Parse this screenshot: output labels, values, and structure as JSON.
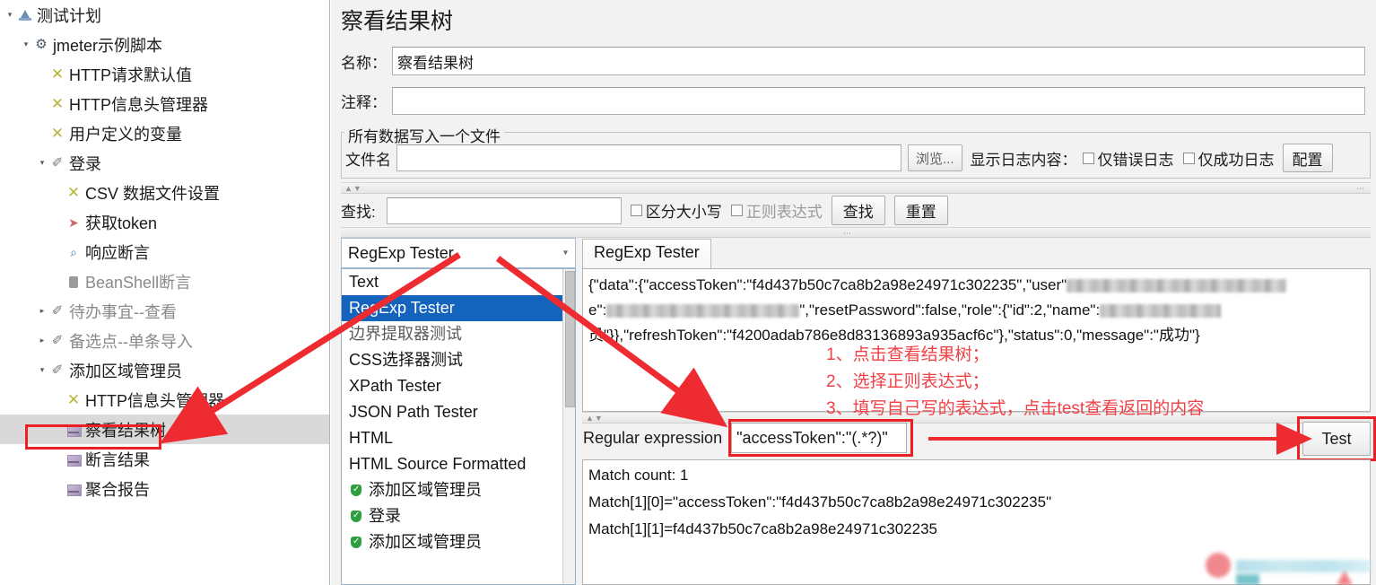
{
  "tree": {
    "items": [
      {
        "label": "测试计划",
        "icon": "test-plan-icon",
        "indent": 0,
        "toggle": "open",
        "dim": false,
        "selected": false
      },
      {
        "label": "jmeter示例脚本",
        "icon": "thread-group-icon",
        "indent": 1,
        "toggle": "open",
        "dim": false,
        "selected": false
      },
      {
        "label": "HTTP请求默认值",
        "icon": "config-element-icon",
        "indent": 2,
        "toggle": "blank",
        "dim": false,
        "selected": false
      },
      {
        "label": "HTTP信息头管理器",
        "icon": "config-element-icon",
        "indent": 2,
        "toggle": "blank",
        "dim": false,
        "selected": false
      },
      {
        "label": "用户定义的变量",
        "icon": "config-element-icon",
        "indent": 2,
        "toggle": "blank",
        "dim": false,
        "selected": false
      },
      {
        "label": "登录",
        "icon": "transaction-controller-icon",
        "indent": 2,
        "toggle": "open",
        "dim": false,
        "selected": false
      },
      {
        "label": "CSV 数据文件设置",
        "icon": "config-element-icon",
        "indent": 3,
        "toggle": "blank",
        "dim": false,
        "selected": false
      },
      {
        "label": "获取token",
        "icon": "http-request-icon",
        "indent": 3,
        "toggle": "blank",
        "dim": false,
        "selected": false
      },
      {
        "label": "响应断言",
        "icon": "assertion-icon",
        "indent": 3,
        "toggle": "blank",
        "dim": false,
        "selected": false
      },
      {
        "label": "BeanShell断言",
        "icon": "beanshell-icon",
        "indent": 3,
        "toggle": "blank",
        "dim": true,
        "selected": false
      },
      {
        "label": "待办事宜--查看",
        "icon": "transaction-controller-icon",
        "indent": 2,
        "toggle": "closed",
        "dim": true,
        "selected": false
      },
      {
        "label": "备选点--单条导入",
        "icon": "transaction-controller-icon",
        "indent": 2,
        "toggle": "closed",
        "dim": true,
        "selected": false
      },
      {
        "label": "添加区域管理员",
        "icon": "transaction-controller-icon",
        "indent": 2,
        "toggle": "open",
        "dim": false,
        "selected": false
      },
      {
        "label": "HTTP信息头管理器",
        "icon": "config-element-icon",
        "indent": 3,
        "toggle": "blank",
        "dim": false,
        "selected": false
      },
      {
        "label": "察看结果树",
        "icon": "listener-icon",
        "indent": 3,
        "toggle": "blank",
        "dim": false,
        "selected": true
      },
      {
        "label": "断言结果",
        "icon": "listener-icon",
        "indent": 3,
        "toggle": "blank",
        "dim": false,
        "selected": false
      },
      {
        "label": "聚合报告",
        "icon": "listener-icon",
        "indent": 3,
        "toggle": "blank",
        "dim": false,
        "selected": false
      }
    ]
  },
  "panel": {
    "title": "察看结果树",
    "name_label": "名称：",
    "name_value": "察看结果树",
    "comment_label": "注释：",
    "comment_value": "",
    "file_group_legend": "所有数据写入一个文件",
    "filename_label": "文件名",
    "filename_value": "",
    "browse_button": "浏览...",
    "log_display_label": "显示日志内容：",
    "only_errors_label": "仅错误日志",
    "only_success_label": "仅成功日志",
    "configure_button": "配置",
    "search_label": "查找:",
    "search_value": "",
    "case_sensitive_label": "区分大小写",
    "regexp_label": "正则表达式",
    "find_button": "查找",
    "reset_button": "重置"
  },
  "renderer": {
    "selected": "RegExp Tester",
    "tab_label": "RegExp Tester",
    "options": [
      {
        "label": "Text",
        "type": "plain",
        "selected": false
      },
      {
        "label": "RegExp Tester",
        "type": "plain",
        "selected": true
      },
      {
        "label": "边界提取器测试",
        "type": "plain-dim",
        "selected": false
      },
      {
        "label": "CSS选择器测试",
        "type": "plain",
        "selected": false
      },
      {
        "label": "XPath Tester",
        "type": "plain",
        "selected": false
      },
      {
        "label": "JSON Path Tester",
        "type": "plain",
        "selected": false
      },
      {
        "label": "HTML",
        "type": "plain",
        "selected": false
      },
      {
        "label": "HTML Source Formatted",
        "type": "plain",
        "selected": false
      },
      {
        "label": "添加区域管理员",
        "type": "shield",
        "selected": false
      },
      {
        "label": "登录",
        "type": "shield",
        "selected": false
      },
      {
        "label": "添加区域管理员",
        "type": "shield",
        "selected": false
      }
    ]
  },
  "response": {
    "line1_a": "{\"data\":{\"accessToken\":\"f4d437b50c7ca8b2a98e24971c302235\",\"user\"",
    "line2_a": "e\":",
    "line2_b": "\",\"resetPassword\":false,\"role\":{\"id\":2,\"name\":",
    "line3_a": "员\"}},\"refreshToken\":\"f4200adab786e8d83136893a935acf6c\"},\"status\":0,\"message\":\"成功\"}"
  },
  "regex": {
    "label": "Regular expression",
    "value": "\"accessToken\":\"(.*?)\"",
    "test_button": "Test"
  },
  "matches": {
    "lines": [
      "Match count: 1",
      "Match[1][0]=\"accessToken\":\"f4d437b50c7ca8b2a98e24971c302235\"",
      "Match[1][1]=f4d437b50c7ca8b2a98e24971c302235"
    ]
  },
  "annotations": {
    "line1": "1、点击查看结果树；",
    "line2": "2、选择正则表达式；",
    "line3": "3、填写自己写的表达式，点击test查看返回的内容"
  },
  "colors": {
    "accent_red": "#ec2024",
    "annotation_red": "#f04046",
    "selection_blue": "#1464bd",
    "tree_selected_bg": "#d9d9d9",
    "panel_bg": "#f2f2f2"
  }
}
